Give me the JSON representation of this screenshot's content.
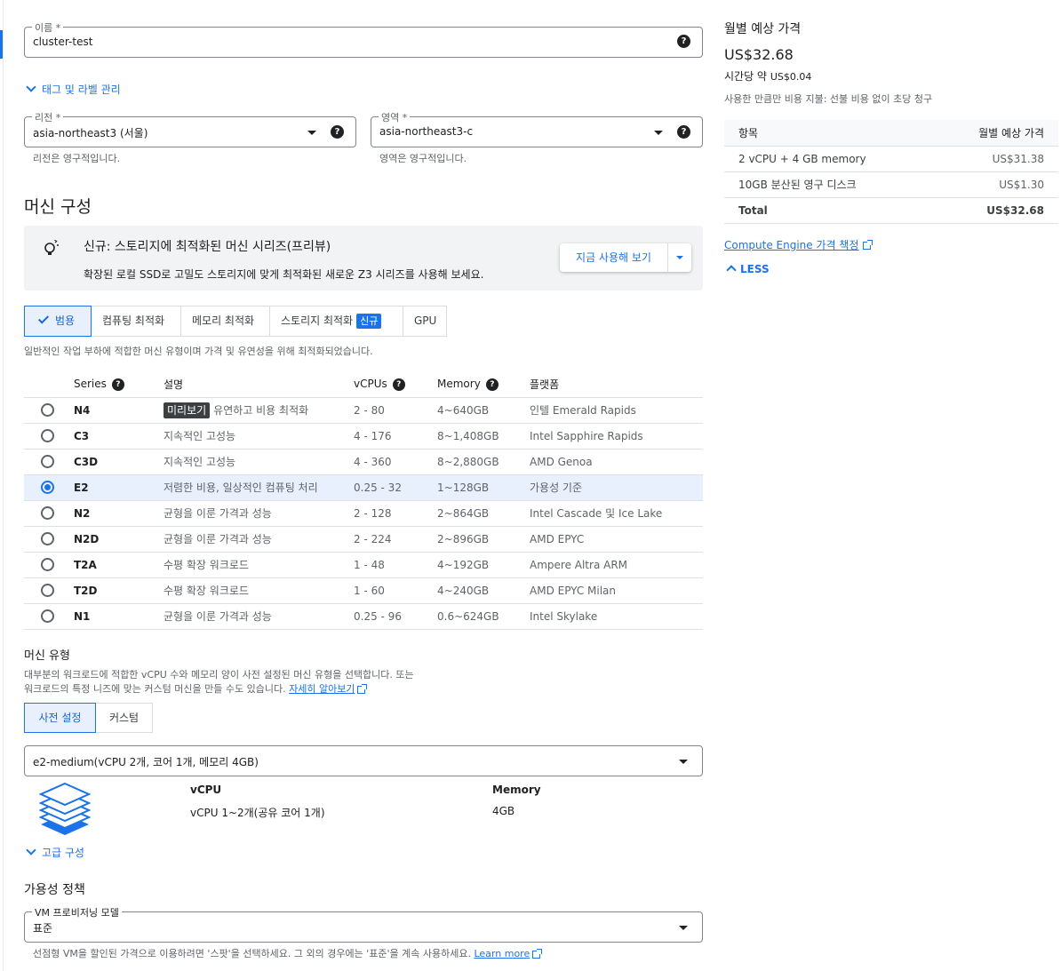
{
  "name_field": {
    "label": "이름 *",
    "value": "cluster-test"
  },
  "tags_toggle": "태그 및 라벨 관리",
  "region_field": {
    "label": "리전 *",
    "value": "asia-northeast3 (서울)",
    "hint": "리전은 영구적입니다."
  },
  "zone_field": {
    "label": "영역 *",
    "value": "asia-northeast3-c",
    "hint": "영역은 영구적입니다."
  },
  "machine_config_title": "머신 구성",
  "banner": {
    "title": "신규: 스토리지에 최적화된 머신 시리즈(프리뷰)",
    "text": "확장된 로컬 SSD로 고밀도 스토리지에 맞게 최적화된 새로운 Z3 시리즈를 사용해 보세요.",
    "button": "지금 사용해 보기"
  },
  "family_tabs": [
    {
      "label": "범용",
      "selected": true
    },
    {
      "label": "컴퓨팅 최적화"
    },
    {
      "label": "메모리 최적화"
    },
    {
      "label": "스토리지 최적화",
      "badge": "신규"
    },
    {
      "label": "GPU"
    }
  ],
  "family_desc": "일반적인 작업 부하에 적합한 머신 유형이며 가격 및 유연성을 위해 최적화되었습니다.",
  "series_table": {
    "headers": [
      "Series",
      "설명",
      "vCPUs",
      "Memory",
      "플랫폼"
    ],
    "rows": [
      {
        "series": "N4",
        "tag": "미리보기",
        "desc": "유연하고 비용 최적화",
        "vcpus": "2 - 80",
        "memory": "4~640GB",
        "platform": "인텔 Emerald Rapids"
      },
      {
        "series": "C3",
        "desc": "지속적인 고성능",
        "vcpus": "4 - 176",
        "memory": "8~1,408GB",
        "platform": "Intel Sapphire Rapids"
      },
      {
        "series": "C3D",
        "desc": "지속적인 고성능",
        "vcpus": "4 - 360",
        "memory": "8~2,880GB",
        "platform": "AMD Genoa"
      },
      {
        "series": "E2",
        "desc": "저렴한 비용, 일상적인 컴퓨팅 처리",
        "vcpus": "0.25 - 32",
        "memory": "1~128GB",
        "platform": "가용성 기준",
        "selected": true
      },
      {
        "series": "N2",
        "desc": "균형을 이룬 가격과 성능",
        "vcpus": "2 - 128",
        "memory": "2~864GB",
        "platform": "Intel Cascade 및 Ice Lake"
      },
      {
        "series": "N2D",
        "desc": "균형을 이룬 가격과 성능",
        "vcpus": "2 - 224",
        "memory": "2~896GB",
        "platform": "AMD EPYC"
      },
      {
        "series": "T2A",
        "desc": "수평 확장 워크로드",
        "vcpus": "1 - 48",
        "memory": "4~192GB",
        "platform": "Ampere Altra ARM"
      },
      {
        "series": "T2D",
        "desc": "수평 확장 워크로드",
        "vcpus": "1 - 60",
        "memory": "4~240GB",
        "platform": "AMD EPYC Milan"
      },
      {
        "series": "N1",
        "desc": "균형을 이룬 가격과 성능",
        "vcpus": "0.25 - 96",
        "memory": "0.6~624GB",
        "platform": "Intel Skylake"
      }
    ]
  },
  "machine_type": {
    "title": "머신 유형",
    "desc1": "대부분의 워크로드에 적합한 vCPU 수와 메모리 양이 사전 설정된 머신 유형을 선택합니다. 또는",
    "desc2": "워크로드의 특정 니즈에 맞는 커스텀 머신을 만들 수도 있습니다.",
    "learn_more": "자세히 알아보기",
    "tabs": [
      {
        "label": "사전 설정",
        "selected": true
      },
      {
        "label": "커스텀"
      }
    ],
    "select_value": "e2-medium(vCPU 2개, 코어 1개, 메모리 4GB)",
    "vcpu_label": "vCPU",
    "vcpu_value": "vCPU 1~2개(공유 코어 1개)",
    "memory_label": "Memory",
    "memory_value": "4GB"
  },
  "advanced_toggle": "고급 구성",
  "availability": {
    "title": "가용성 정책",
    "field_label": "VM 프로비저닝 모델",
    "field_value": "표준",
    "hint": "선점형 VM을 할인된 가격으로 이용하려면 '스팟'을 선택하세요. 그 외의 경우에는 '표준'을 계속 사용하세요.",
    "learn_more": "Learn more"
  },
  "pricing": {
    "title": "월별 예상 가격",
    "total": "US$32.68",
    "hourly_prefix": "시간당 약",
    "hourly": "US$0.04",
    "note": "사용한 만큼만 비용 지불: 선불 비용 없이 초당 청구",
    "headers": [
      "항목",
      "월별 예상 가격"
    ],
    "rows": [
      {
        "item": "2 vCPU + 4 GB memory",
        "price": "US$31.38"
      },
      {
        "item": "10GB 분산된 영구 디스크",
        "price": "US$1.30"
      },
      {
        "item": "Total",
        "price": "US$32.68"
      }
    ],
    "link": "Compute Engine 가격 책정",
    "less": "LESS"
  },
  "colors": {
    "accent": "#1a73e8",
    "selected_bg": "#e8f0fe"
  }
}
